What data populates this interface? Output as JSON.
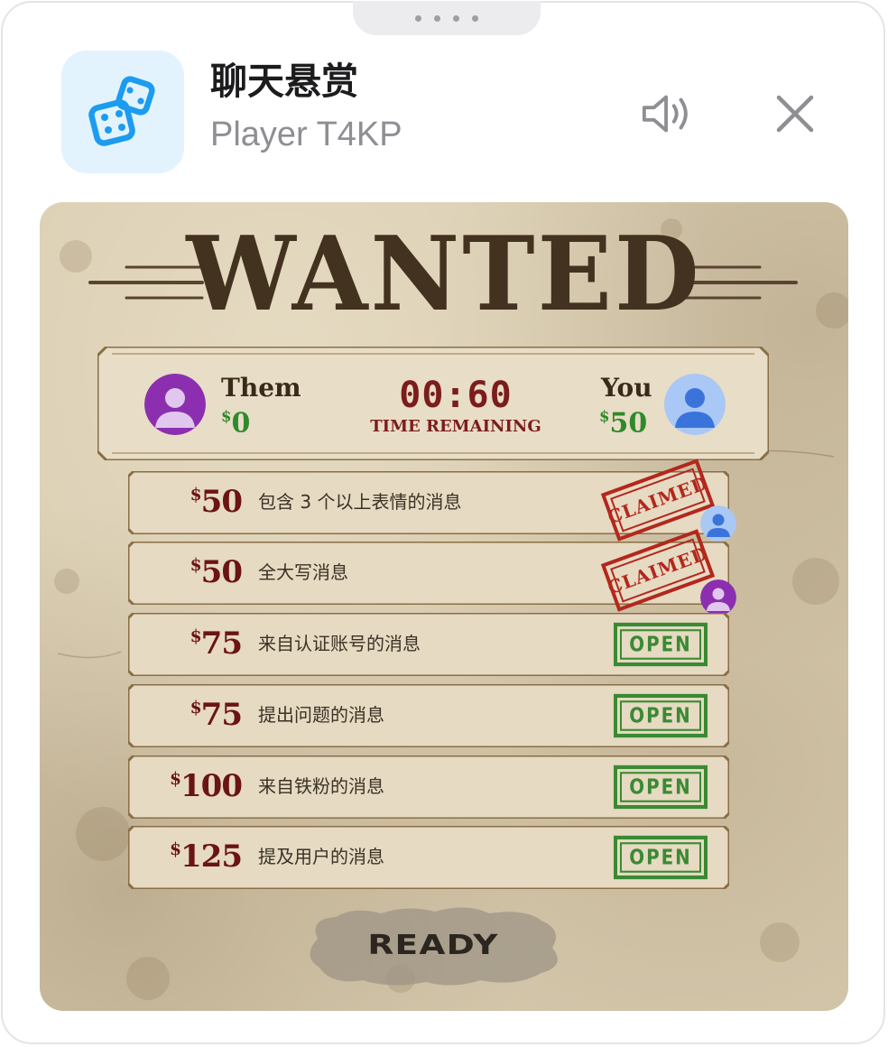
{
  "header": {
    "title": "聊天悬赏",
    "subtitle": "Player T4KP",
    "sound_icon": "speaker-icon",
    "close_icon": "close-icon",
    "app_icon": "dice-icon",
    "app_icon_color": "#1c9cf0"
  },
  "poster": {
    "heading": "WANTED",
    "scoreboard": {
      "them_label": "Them",
      "them_amount": "0",
      "you_label": "You",
      "you_amount": "50",
      "timer": "00:60",
      "timer_label": "TIME REMAINING"
    },
    "bounties": [
      {
        "amount": "50",
        "description": "包含 3 个以上表情的消息",
        "status": "CLAIMED",
        "claimed_by": "you"
      },
      {
        "amount": "50",
        "description": "全大写消息",
        "status": "CLAIMED",
        "claimed_by": "them"
      },
      {
        "amount": "75",
        "description": "来自认证账号的消息",
        "status": "OPEN"
      },
      {
        "amount": "75",
        "description": "提出问题的消息",
        "status": "OPEN"
      },
      {
        "amount": "100",
        "description": "来自铁粉的消息",
        "status": "OPEN"
      },
      {
        "amount": "125",
        "description": "提及用户的消息",
        "status": "OPEN"
      }
    ],
    "ready_label": "READY",
    "colors": {
      "paper": "#d8cbaf",
      "ink_dark": "#43321f",
      "amount_red": "#6b1414",
      "money_green": "#2f8a2a",
      "open_green": "#3a8a33",
      "claimed_red": "#b3271c",
      "them_avatar": "#8b2fb0",
      "you_avatar": "#3a74db"
    }
  }
}
